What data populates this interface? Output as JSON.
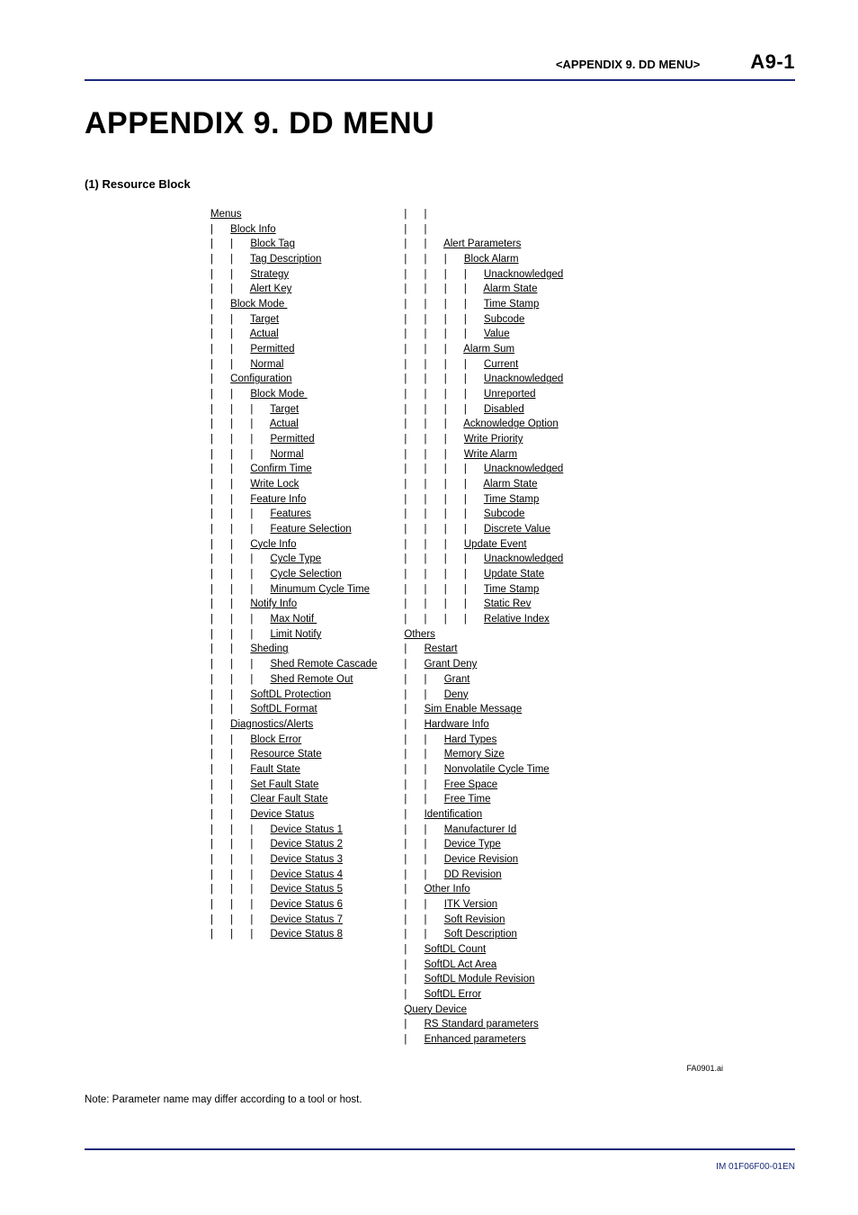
{
  "header": {
    "section_label": "<APPENDIX 9.  DD MENU>",
    "page_num": "A9-1"
  },
  "title": "APPENDIX 9.  DD MENU",
  "subsection": "(1)  Resource Block",
  "figure_ref": "FA0901.ai",
  "note": "Note: Parameter name may differ according to a tool or host.",
  "footer": "IM 01F06F00-01EN",
  "tree": {
    "col1": [
      {
        "d": 0,
        "t": "Menus"
      },
      {
        "d": 1,
        "t": "Block Info"
      },
      {
        "d": 2,
        "t": "Block Tag"
      },
      {
        "d": 2,
        "t": "Tag Description"
      },
      {
        "d": 2,
        "t": "Strategy"
      },
      {
        "d": 2,
        "t": "Alert Key"
      },
      {
        "d": 1,
        "t": "Block Mode "
      },
      {
        "d": 2,
        "t": "Target"
      },
      {
        "d": 2,
        "t": "Actual"
      },
      {
        "d": 2,
        "t": "Permitted"
      },
      {
        "d": 2,
        "t": "Normal"
      },
      {
        "d": 1,
        "t": "Configuration"
      },
      {
        "d": 2,
        "t": "Block Mode "
      },
      {
        "d": 3,
        "t": "Target"
      },
      {
        "d": 3,
        "t": "Actual"
      },
      {
        "d": 3,
        "t": "Permitted"
      },
      {
        "d": 3,
        "t": "Normal"
      },
      {
        "d": 2,
        "t": "Confirm Time"
      },
      {
        "d": 2,
        "t": "Write Lock"
      },
      {
        "d": 2,
        "t": "Feature Info"
      },
      {
        "d": 3,
        "t": "Features"
      },
      {
        "d": 3,
        "t": "Feature Selection"
      },
      {
        "d": 2,
        "t": "Cycle Info"
      },
      {
        "d": 3,
        "t": "Cycle Type"
      },
      {
        "d": 3,
        "t": "Cycle Selection"
      },
      {
        "d": 3,
        "t": "Minumum Cycle Time"
      },
      {
        "d": 2,
        "t": "Notify Info"
      },
      {
        "d": 3,
        "t": "Max Notif "
      },
      {
        "d": 3,
        "t": "Limit Notify"
      },
      {
        "d": 2,
        "t": "Sheding"
      },
      {
        "d": 3,
        "t": "Shed Remote Cascade"
      },
      {
        "d": 3,
        "t": "Shed Remote Out"
      },
      {
        "d": 2,
        "t": "SoftDL Protection"
      },
      {
        "d": 2,
        "t": "SoftDL Format"
      },
      {
        "d": 1,
        "t": "Diagnostics/Alerts"
      },
      {
        "d": 2,
        "t": "Block Error"
      },
      {
        "d": 2,
        "t": "Resource State"
      },
      {
        "d": 2,
        "t": "Fault State"
      },
      {
        "d": 2,
        "t": "Set Fault State"
      },
      {
        "d": 2,
        "t": "Clear Fault State"
      },
      {
        "d": 2,
        "t": "Device Status"
      },
      {
        "d": 3,
        "t": "Device Status 1"
      },
      {
        "d": 3,
        "t": "Device Status 2"
      },
      {
        "d": 3,
        "t": "Device Status 3"
      },
      {
        "d": 3,
        "t": "Device Status 4"
      },
      {
        "d": 3,
        "t": "Device Status 5"
      },
      {
        "d": 3,
        "t": "Device Status 6"
      },
      {
        "d": 3,
        "t": "Device Status 7"
      },
      {
        "d": 3,
        "t": "Device Status 8"
      }
    ],
    "col2_pre": [
      {
        "pipes": 2,
        "t": ""
      },
      {
        "pipes": 2,
        "t": ""
      }
    ],
    "col2": [
      {
        "d": 2,
        "t": "Alert Parameters",
        "base": 1
      },
      {
        "d": 3,
        "t": "Block Alarm",
        "base": 1
      },
      {
        "d": 4,
        "t": "Unacknowledged",
        "base": 1
      },
      {
        "d": 4,
        "t": "Alarm State",
        "base": 1
      },
      {
        "d": 4,
        "t": "Time Stamp",
        "base": 1
      },
      {
        "d": 4,
        "t": "Subcode",
        "base": 1
      },
      {
        "d": 4,
        "t": "Value",
        "base": 1
      },
      {
        "d": 3,
        "t": "Alarm Sum",
        "base": 1
      },
      {
        "d": 4,
        "t": "Current",
        "base": 1
      },
      {
        "d": 4,
        "t": "Unacknowledged",
        "base": 1
      },
      {
        "d": 4,
        "t": "Unreported",
        "base": 1
      },
      {
        "d": 4,
        "t": "Disabled",
        "base": 1
      },
      {
        "d": 3,
        "t": "Acknowledge Option",
        "base": 1
      },
      {
        "d": 3,
        "t": "Write Priority",
        "base": 1
      },
      {
        "d": 3,
        "t": "Write Alarm",
        "base": 1
      },
      {
        "d": 4,
        "t": "Unacknowledged",
        "base": 1
      },
      {
        "d": 4,
        "t": "Alarm State",
        "base": 1
      },
      {
        "d": 4,
        "t": "Time Stamp",
        "base": 1
      },
      {
        "d": 4,
        "t": "Subcode",
        "base": 1
      },
      {
        "d": 4,
        "t": "Discrete Value",
        "base": 1
      },
      {
        "d": 3,
        "t": "Update Event",
        "base": 1
      },
      {
        "d": 4,
        "t": "Unacknowledged",
        "base": 1
      },
      {
        "d": 4,
        "t": "Update State",
        "base": 1
      },
      {
        "d": 4,
        "t": "Time Stamp",
        "base": 1
      },
      {
        "d": 4,
        "t": "Static Rev",
        "base": 1
      },
      {
        "d": 4,
        "t": "Relative Index",
        "base": 1
      },
      {
        "d": 0,
        "t": "Others",
        "base": 0
      },
      {
        "d": 1,
        "t": "Restart",
        "base": 0
      },
      {
        "d": 1,
        "t": "Grant Deny",
        "base": 0
      },
      {
        "d": 2,
        "t": "Grant",
        "base": 0
      },
      {
        "d": 2,
        "t": "Deny",
        "base": 0
      },
      {
        "d": 1,
        "t": "Sim Enable Message",
        "base": 0
      },
      {
        "d": 1,
        "t": "Hardware Info",
        "base": 0
      },
      {
        "d": 2,
        "t": "Hard Types",
        "base": 0
      },
      {
        "d": 2,
        "t": "Memory Size",
        "base": 0
      },
      {
        "d": 2,
        "t": "Nonvolatile Cycle Time",
        "base": 0
      },
      {
        "d": 2,
        "t": "Free Space",
        "base": 0
      },
      {
        "d": 2,
        "t": "Free Time",
        "base": 0
      },
      {
        "d": 1,
        "t": "Identification",
        "base": 0
      },
      {
        "d": 2,
        "t": "Manufacturer Id",
        "base": 0
      },
      {
        "d": 2,
        "t": "Device Type",
        "base": 0
      },
      {
        "d": 2,
        "t": "Device Revision",
        "base": 0
      },
      {
        "d": 2,
        "t": "DD Revision",
        "base": 0
      },
      {
        "d": 1,
        "t": "Other Info",
        "base": 0
      },
      {
        "d": 2,
        "t": "ITK Version",
        "base": 0
      },
      {
        "d": 2,
        "t": "Soft Revision",
        "base": 0
      },
      {
        "d": 2,
        "t": "Soft Description",
        "base": 0
      },
      {
        "d": 1,
        "t": "SoftDL Count",
        "base": 0
      },
      {
        "d": 1,
        "t": "SoftDL Act Area",
        "base": 0
      },
      {
        "d": 1,
        "t": "SoftDL Module Revision",
        "base": 0
      },
      {
        "d": 1,
        "t": "SoftDL Error",
        "base": 0
      },
      {
        "d": 0,
        "t": "Query Device",
        "base": 0
      },
      {
        "d": 1,
        "t": "RS Standard parameters",
        "base": 0
      },
      {
        "d": 1,
        "t": "Enhanced parameters",
        "base": 0
      }
    ]
  }
}
